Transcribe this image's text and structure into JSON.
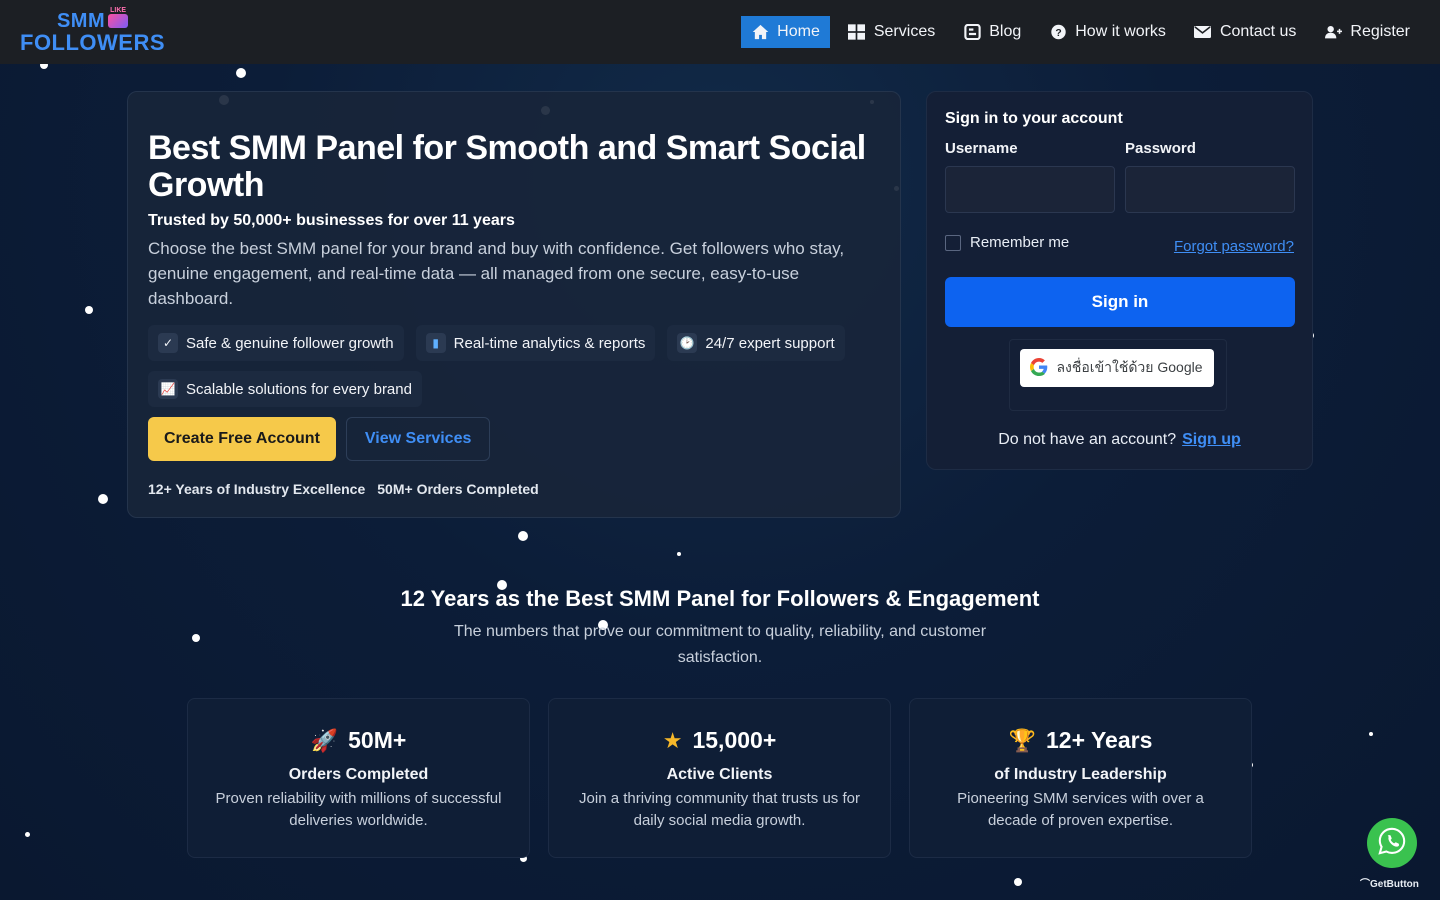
{
  "logo": {
    "line1": "SMM",
    "badge": "LIKE",
    "line2": "FOLLOWERS"
  },
  "nav": [
    {
      "label": "Home",
      "icon": "home-icon",
      "active": true
    },
    {
      "label": "Services",
      "icon": "grid-icon"
    },
    {
      "label": "Blog",
      "icon": "blogger-icon"
    },
    {
      "label": "How it works",
      "icon": "question-icon"
    },
    {
      "label": "Contact us",
      "icon": "envelope-icon"
    },
    {
      "label": "Register",
      "icon": "user-plus-icon"
    }
  ],
  "hero": {
    "title": "Best SMM Panel for Smooth and Smart Social Growth",
    "trusted": "Trusted by 50,000+ businesses for over 11 years",
    "description": "Choose the best SMM panel for your brand and buy with confidence. Get followers who stay, genuine engagement, and real-time data — all managed from one secure, easy-to-use dashboard.",
    "features": [
      {
        "icon": "checkmark-icon",
        "glyph": "✓",
        "label": "Safe & genuine follower growth"
      },
      {
        "icon": "bar-chart-icon",
        "glyph": "▮",
        "label": "Real-time analytics & reports"
      },
      {
        "icon": "clock-icon",
        "glyph": "🕑",
        "label": "24/7 expert support"
      },
      {
        "icon": "trend-up-icon",
        "glyph": "📈",
        "label": "Scalable solutions for every brand"
      }
    ],
    "primary_button": "Create Free Account",
    "secondary_button": "View Services",
    "stats": [
      "12+ Years of Industry Excellence",
      "50M+ Orders Completed"
    ]
  },
  "signin": {
    "title": "Sign in to your account",
    "username_label": "Username",
    "password_label": "Password",
    "username_value": "",
    "password_value": "",
    "remember_label": "Remember me",
    "forgot_label": "Forgot password?",
    "signin_button": "Sign in",
    "google_button": "ลงชื่อเข้าใช้ด้วย Google",
    "no_account_text": "Do not have an account?",
    "signup_link": "Sign up"
  },
  "section": {
    "title": "12 Years as the Best SMM Panel for Followers & Engagement",
    "subtitle": "The numbers that prove our commitment to quality, reliability, and customer satisfaction."
  },
  "cards": [
    {
      "icon": "rocket-icon",
      "glyph": "🚀",
      "number": "50M+",
      "title": "Orders Completed",
      "desc": "Proven reliability with millions of successful deliveries worldwide."
    },
    {
      "icon": "star-icon",
      "glyph": "★",
      "number": "15,000+",
      "title": "Active Clients",
      "desc": "Join a thriving community that trusts us for daily social media growth."
    },
    {
      "icon": "trophy-icon",
      "glyph": "🏆",
      "number": "12+ Years",
      "title": "of Industry Leadership",
      "desc": "Pioneering SMM services with over a decade of proven expertise."
    }
  ],
  "floating": {
    "getbutton_label": "GetButton"
  },
  "colors": {
    "accent": "#0d63f0",
    "nav_active": "#1f7ad6",
    "cta_yellow": "#f6c94a",
    "link": "#3f8ef5",
    "whatsapp": "#3ac24f"
  }
}
